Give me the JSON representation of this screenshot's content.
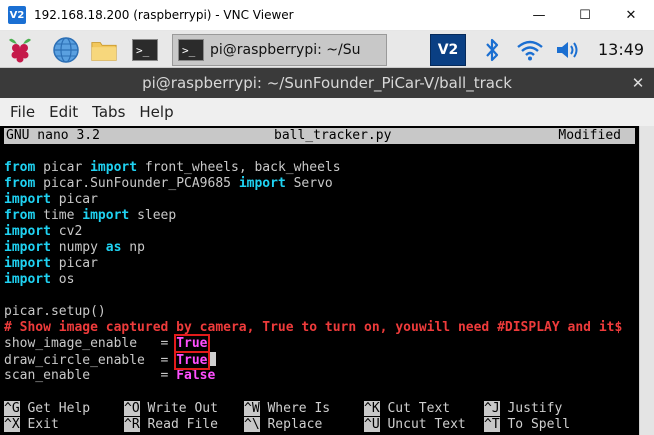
{
  "window": {
    "title": "192.168.18.200 (raspberrypi) - VNC Viewer",
    "logo": "V2",
    "minimize": "—",
    "maximize": "☐",
    "close": "✕"
  },
  "taskbar": {
    "icons": [
      "raspberry-menu-icon",
      "web-browser-icon",
      "file-manager-icon",
      "terminal-icon"
    ],
    "terminal_prompt": ">_",
    "active_task": "pi@raspberrypi: ~/Su",
    "vnc_label": "V2",
    "clock": "13:49"
  },
  "terminal": {
    "title": "pi@raspberrypi: ~/SunFounder_PiCar-V/ball_track",
    "close": "✕",
    "menu": [
      "File",
      "Edit",
      "Tabs",
      "Help"
    ]
  },
  "nano": {
    "version": "GNU nano 3.2",
    "filename": "ball_tracker.py",
    "status": "Modified"
  },
  "code": [
    {
      "segs": [
        {
          "t": "from",
          "c": "kw"
        },
        {
          "t": " picar ",
          "c": "txt"
        },
        {
          "t": "import",
          "c": "kw"
        },
        {
          "t": " front_wheels, back_wheels",
          "c": "txt"
        }
      ]
    },
    {
      "segs": [
        {
          "t": "from",
          "c": "kw"
        },
        {
          "t": " picar.SunFounder_PCA9685 ",
          "c": "txt"
        },
        {
          "t": "import",
          "c": "kw"
        },
        {
          "t": " Servo",
          "c": "txt"
        }
      ]
    },
    {
      "segs": [
        {
          "t": "import",
          "c": "kw"
        },
        {
          "t": " picar",
          "c": "txt"
        }
      ]
    },
    {
      "segs": [
        {
          "t": "from",
          "c": "kw"
        },
        {
          "t": " time ",
          "c": "txt"
        },
        {
          "t": "import",
          "c": "kw"
        },
        {
          "t": " sleep",
          "c": "txt"
        }
      ]
    },
    {
      "segs": [
        {
          "t": "import",
          "c": "kw"
        },
        {
          "t": " cv2",
          "c": "txt"
        }
      ]
    },
    {
      "segs": [
        {
          "t": "import",
          "c": "kw"
        },
        {
          "t": " numpy ",
          "c": "txt"
        },
        {
          "t": "as",
          "c": "kw"
        },
        {
          "t": " np",
          "c": "txt"
        }
      ]
    },
    {
      "segs": [
        {
          "t": "import",
          "c": "kw"
        },
        {
          "t": " picar",
          "c": "txt"
        }
      ]
    },
    {
      "segs": [
        {
          "t": "import",
          "c": "kw"
        },
        {
          "t": " os",
          "c": "txt"
        }
      ]
    },
    {
      "segs": []
    },
    {
      "segs": [
        {
          "t": "picar.setup()",
          "c": "txt"
        }
      ]
    },
    {
      "segs": [
        {
          "t": "# Show image captured by camera, True to turn on, youwill need #DISPLAY and it$",
          "c": "comment"
        }
      ]
    },
    {
      "segs": [
        {
          "t": "show_image_enable   = ",
          "c": "txt"
        },
        {
          "t": "True",
          "c": "bool",
          "hl": true
        }
      ]
    },
    {
      "segs": [
        {
          "t": "draw_circle_enable  = ",
          "c": "txt"
        },
        {
          "t": "True",
          "c": "bool",
          "hl": true,
          "cursor": true
        }
      ]
    },
    {
      "segs": [
        {
          "t": "scan_enable         = ",
          "c": "txt"
        },
        {
          "t": "False",
          "c": "bool"
        }
      ]
    }
  ],
  "help": [
    [
      {
        "k": "^G",
        "l": "Get Help"
      },
      {
        "k": "^O",
        "l": "Write Out"
      },
      {
        "k": "^W",
        "l": "Where Is"
      },
      {
        "k": "^K",
        "l": "Cut Text"
      },
      {
        "k": "^J",
        "l": "Justify"
      }
    ],
    [
      {
        "k": "^X",
        "l": "Exit"
      },
      {
        "k": "^R",
        "l": "Read File"
      },
      {
        "k": "^\\",
        "l": "Replace"
      },
      {
        "k": "^U",
        "l": "Uncut Text"
      },
      {
        "k": "^T",
        "l": "To Spell"
      }
    ]
  ]
}
